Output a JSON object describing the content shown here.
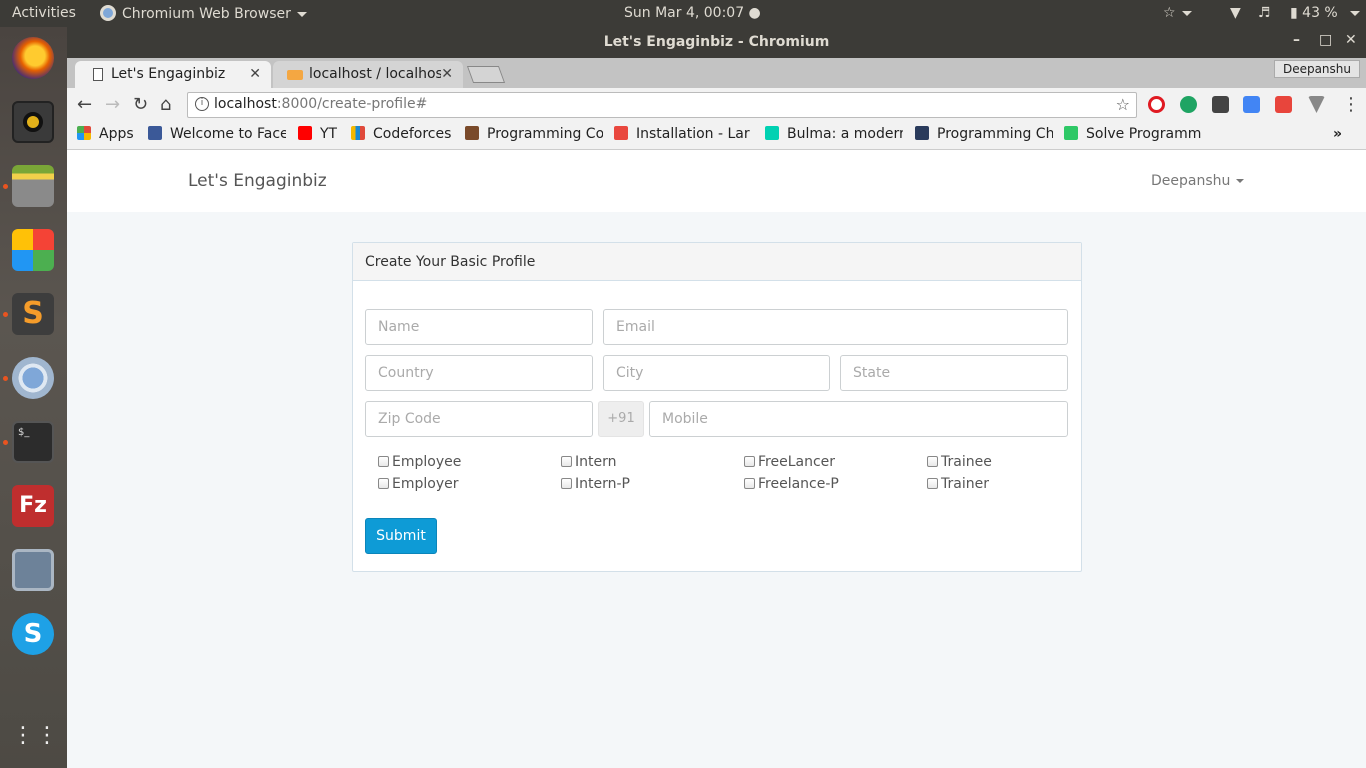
{
  "topbar": {
    "activities": "Activities",
    "app_menu": "Chromium Web Browser",
    "clock": "Sun Mar  4, 00:07 ●",
    "battery": "43 %"
  },
  "window": {
    "title": "Let's Engaginbiz - Chromium",
    "profile": "Deepanshu"
  },
  "tabs": [
    {
      "label": "Let's Engaginbiz"
    },
    {
      "label": "localhost / localhos"
    }
  ],
  "omnibox": {
    "host": "localhost",
    "path": ":8000/create-profile#"
  },
  "bookmarks": [
    {
      "label": "Apps",
      "color": "#e04a3b"
    },
    {
      "label": "Welcome to Face",
      "color": "#3b5998"
    },
    {
      "label": "YT",
      "color": "#ff0000"
    },
    {
      "label": "Codeforces",
      "color": "#f5b800"
    },
    {
      "label": "Programming Co",
      "color": "#7a4a2a"
    },
    {
      "label": "Installation - Lar",
      "color": "#e9473e"
    },
    {
      "label": "Bulma: a moderr",
      "color": "#00d1b2"
    },
    {
      "label": "Programming Ch",
      "color": "#2a3b5c"
    },
    {
      "label": "Solve Programm",
      "color": "#2ec866"
    }
  ],
  "navbar": {
    "brand": "Let's Engaginbiz",
    "user": "Deepanshu"
  },
  "form": {
    "heading": "Create Your Basic Profile",
    "name_ph": "Name",
    "email_ph": "Email",
    "country_ph": "Country",
    "city_ph": "City",
    "state_ph": "State",
    "zip_ph": "Zip Code",
    "dial_code": "+91",
    "mobile_ph": "Mobile",
    "roles": {
      "employee": "Employee",
      "employer": "Employer",
      "intern": "Intern",
      "intern_p": "Intern-P",
      "freelancer": "FreeLancer",
      "freelance_p": "Freelance-P",
      "trainee": "Trainee",
      "trainer": "Trainer"
    },
    "submit": "Submit"
  }
}
